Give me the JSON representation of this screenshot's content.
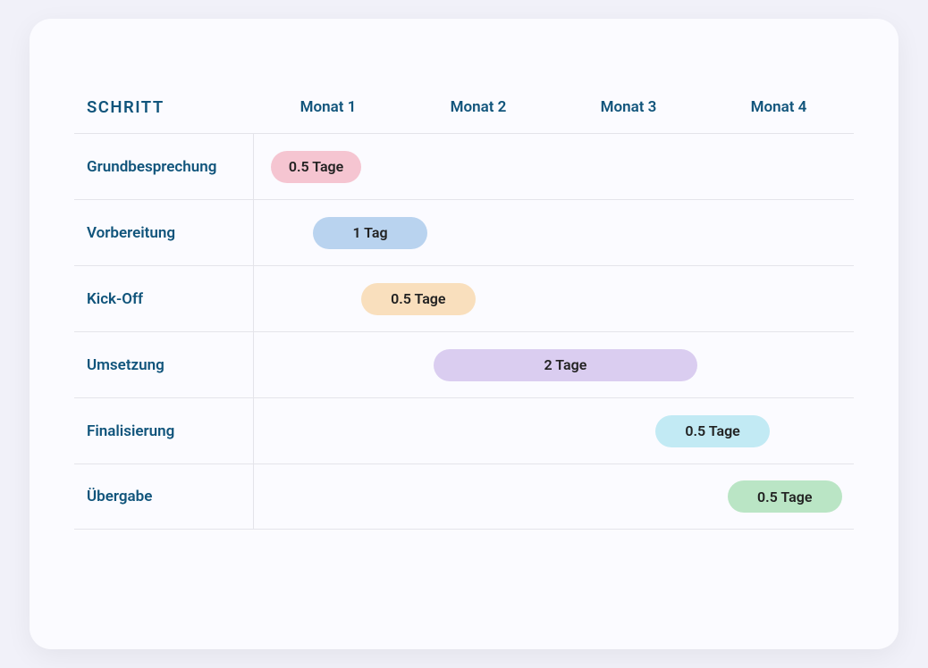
{
  "header": {
    "step_label": "Schritt",
    "months": [
      "Monat 1",
      "Monat 2",
      "Monat 3",
      "Monat 4"
    ]
  },
  "rows": [
    {
      "name": "Grundbesprechung",
      "bar_label": "0.5 Tage",
      "color": "c-pink",
      "left_pct": 3,
      "width_pct": 15
    },
    {
      "name": "Vorbereitung",
      "bar_label": "1 Tag",
      "color": "c-blue",
      "left_pct": 10,
      "width_pct": 19
    },
    {
      "name": "Kick-Off",
      "bar_label": "0.5 Tage",
      "color": "c-orange",
      "left_pct": 18,
      "width_pct": 19
    },
    {
      "name": "Umsetzung",
      "bar_label": "2 Tage",
      "color": "c-purple",
      "left_pct": 30,
      "width_pct": 44
    },
    {
      "name": "Finalisierung",
      "bar_label": "0.5 Tage",
      "color": "c-cyan",
      "left_pct": 67,
      "width_pct": 19
    },
    {
      "name": "Übergabe",
      "bar_label": "0.5 Tage",
      "color": "c-green",
      "left_pct": 79,
      "width_pct": 19
    }
  ],
  "chart_data": {
    "type": "bar",
    "orientation": "horizontal-gantt",
    "title": "",
    "xlabel": "",
    "ylabel": "Schritt",
    "x_categories": [
      "Monat 1",
      "Monat 2",
      "Monat 3",
      "Monat 4"
    ],
    "xlim": [
      0,
      4
    ],
    "series": [
      {
        "name": "Grundbesprechung",
        "start_month": 0.05,
        "end_month": 0.6,
        "duration_label": "0.5 Tage",
        "color": "#f5c5d1"
      },
      {
        "name": "Vorbereitung",
        "start_month": 0.35,
        "end_month": 1.1,
        "duration_label": "1 Tag",
        "color": "#b9d3ef"
      },
      {
        "name": "Kick-Off",
        "start_month": 0.7,
        "end_month": 1.45,
        "duration_label": "0.5 Tage",
        "color": "#f9dfbd"
      },
      {
        "name": "Umsetzung",
        "start_month": 1.2,
        "end_month": 2.95,
        "duration_label": "2 Tage",
        "color": "#dacdf0"
      },
      {
        "name": "Finalisierung",
        "start_month": 2.65,
        "end_month": 3.4,
        "duration_label": "0.5 Tage",
        "color": "#c2eaf4"
      },
      {
        "name": "Übergabe",
        "start_month": 3.15,
        "end_month": 3.9,
        "duration_label": "0.5 Tage",
        "color": "#bae5c5"
      }
    ]
  }
}
